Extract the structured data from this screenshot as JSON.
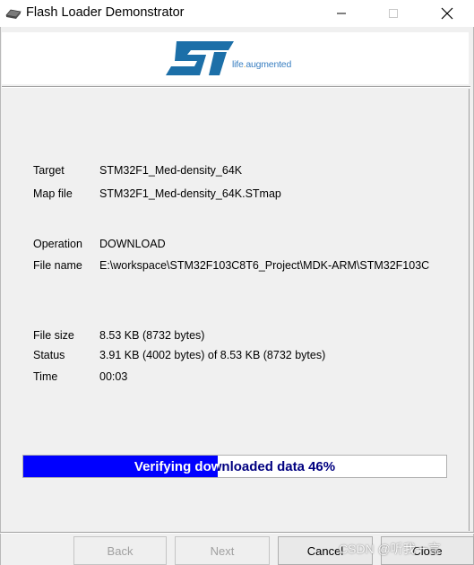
{
  "window": {
    "title": "Flash Loader Demonstrator",
    "icon": "chip-icon"
  },
  "banner": {
    "logo_icon": "st-logo-icon",
    "tagline_part1": "life",
    "tagline_dot": ".",
    "tagline_part2": "augmented"
  },
  "info": {
    "target_label": "Target",
    "target_value": "STM32F1_Med-density_64K",
    "mapfile_label": "Map file",
    "mapfile_value": "STM32F1_Med-density_64K.STmap",
    "operation_label": "Operation",
    "operation_value": "DOWNLOAD",
    "filename_label": "File name",
    "filename_value": "E:\\workspace\\STM32F103C8T6_Project\\MDK-ARM\\STM32F103C",
    "filesize_label": "File size",
    "filesize_value": "8.53 KB (8732 bytes)",
    "status_label": "Status",
    "status_value": "3.91 KB (4002 bytes) of 8.53 KB (8732 bytes)",
    "time_label": "Time",
    "time_value": "00:03"
  },
  "progress": {
    "text": "Verifying downloaded data 46%",
    "percent": 46
  },
  "buttons": {
    "back": "Back",
    "next": "Next",
    "cancel": "Cancel",
    "close": "Close"
  },
  "watermark": "CSDN @听我一言",
  "colors": {
    "progress_fill": "#0000ff",
    "progress_text": "#000080",
    "tagline": "#3a7fc1",
    "logo": "#1c6fa8"
  }
}
